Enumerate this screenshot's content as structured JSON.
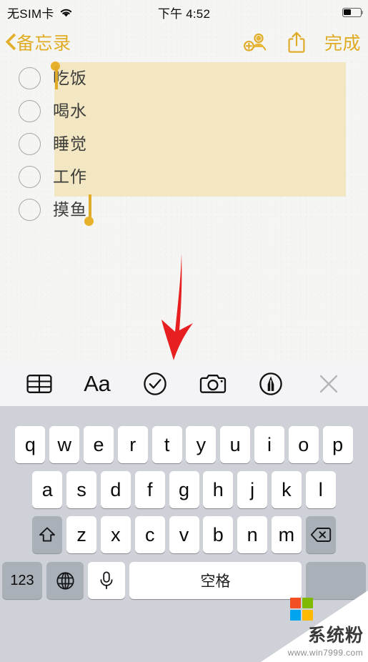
{
  "status_bar": {
    "carrier": "无SIM卡",
    "wifi_icon": "wifi-icon",
    "time": "下午 4:52",
    "battery_icon": "battery-icon",
    "battery_level_percent": 45
  },
  "nav_bar": {
    "back_label": "备忘录",
    "back_icon": "chevron-left-icon",
    "add_person_icon": "add-person-icon",
    "share_icon": "share-icon",
    "done_label": "完成"
  },
  "note": {
    "checklist_items": [
      {
        "label": "吃饭",
        "checked": false
      },
      {
        "label": "喝水",
        "checked": false
      },
      {
        "label": "睡觉",
        "checked": false
      },
      {
        "label": "工作",
        "checked": false
      },
      {
        "label": "摸鱼",
        "checked": false
      }
    ],
    "selection_highlight_color": "#f2e7c2",
    "selection_handle_color": "#e0ab28"
  },
  "annotation": {
    "arrow_color": "#e81f20",
    "points_to": "checklist-toolbar-button"
  },
  "toolbar": {
    "items": [
      {
        "icon": "table-icon",
        "name": "table-button"
      },
      {
        "icon": "text-format-icon",
        "label": "Aa",
        "name": "format-button"
      },
      {
        "icon": "checklist-icon",
        "name": "checklist-button"
      },
      {
        "icon": "camera-icon",
        "name": "camera-button"
      },
      {
        "icon": "markup-pen-icon",
        "name": "markup-button"
      },
      {
        "icon": "close-icon",
        "name": "close-toolbar-button"
      }
    ]
  },
  "keyboard": {
    "row1": [
      "q",
      "w",
      "e",
      "r",
      "t",
      "y",
      "u",
      "i",
      "o",
      "p"
    ],
    "row2": [
      "a",
      "s",
      "d",
      "f",
      "g",
      "h",
      "j",
      "k",
      "l"
    ],
    "row3": [
      "z",
      "x",
      "c",
      "v",
      "b",
      "n",
      "m"
    ],
    "shift_icon": "shift-icon",
    "delete_icon": "backspace-icon",
    "numeric_label": "123",
    "globe_icon": "globe-icon",
    "mic_icon": "microphone-icon",
    "space_label": "空格"
  },
  "watermark": {
    "title": "系统粉",
    "url": "www.win7999.com",
    "logo_colors": [
      "#f25022",
      "#7fba00",
      "#00a4ef",
      "#ffb900"
    ]
  }
}
